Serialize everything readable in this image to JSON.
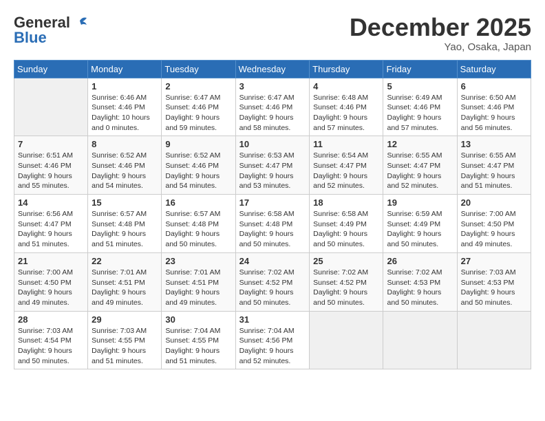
{
  "header": {
    "logo_general": "General",
    "logo_blue": "Blue",
    "month_title": "December 2025",
    "location": "Yao, Osaka, Japan"
  },
  "days_of_week": [
    "Sunday",
    "Monday",
    "Tuesday",
    "Wednesday",
    "Thursday",
    "Friday",
    "Saturday"
  ],
  "weeks": [
    [
      {
        "day": "",
        "content": ""
      },
      {
        "day": "1",
        "content": "Sunrise: 6:46 AM\nSunset: 4:46 PM\nDaylight: 10 hours\nand 0 minutes."
      },
      {
        "day": "2",
        "content": "Sunrise: 6:47 AM\nSunset: 4:46 PM\nDaylight: 9 hours\nand 59 minutes."
      },
      {
        "day": "3",
        "content": "Sunrise: 6:47 AM\nSunset: 4:46 PM\nDaylight: 9 hours\nand 58 minutes."
      },
      {
        "day": "4",
        "content": "Sunrise: 6:48 AM\nSunset: 4:46 PM\nDaylight: 9 hours\nand 57 minutes."
      },
      {
        "day": "5",
        "content": "Sunrise: 6:49 AM\nSunset: 4:46 PM\nDaylight: 9 hours\nand 57 minutes."
      },
      {
        "day": "6",
        "content": "Sunrise: 6:50 AM\nSunset: 4:46 PM\nDaylight: 9 hours\nand 56 minutes."
      }
    ],
    [
      {
        "day": "7",
        "content": "Sunrise: 6:51 AM\nSunset: 4:46 PM\nDaylight: 9 hours\nand 55 minutes."
      },
      {
        "day": "8",
        "content": "Sunrise: 6:52 AM\nSunset: 4:46 PM\nDaylight: 9 hours\nand 54 minutes."
      },
      {
        "day": "9",
        "content": "Sunrise: 6:52 AM\nSunset: 4:46 PM\nDaylight: 9 hours\nand 54 minutes."
      },
      {
        "day": "10",
        "content": "Sunrise: 6:53 AM\nSunset: 4:47 PM\nDaylight: 9 hours\nand 53 minutes."
      },
      {
        "day": "11",
        "content": "Sunrise: 6:54 AM\nSunset: 4:47 PM\nDaylight: 9 hours\nand 52 minutes."
      },
      {
        "day": "12",
        "content": "Sunrise: 6:55 AM\nSunset: 4:47 PM\nDaylight: 9 hours\nand 52 minutes."
      },
      {
        "day": "13",
        "content": "Sunrise: 6:55 AM\nSunset: 4:47 PM\nDaylight: 9 hours\nand 51 minutes."
      }
    ],
    [
      {
        "day": "14",
        "content": "Sunrise: 6:56 AM\nSunset: 4:47 PM\nDaylight: 9 hours\nand 51 minutes."
      },
      {
        "day": "15",
        "content": "Sunrise: 6:57 AM\nSunset: 4:48 PM\nDaylight: 9 hours\nand 51 minutes."
      },
      {
        "day": "16",
        "content": "Sunrise: 6:57 AM\nSunset: 4:48 PM\nDaylight: 9 hours\nand 50 minutes."
      },
      {
        "day": "17",
        "content": "Sunrise: 6:58 AM\nSunset: 4:48 PM\nDaylight: 9 hours\nand 50 minutes."
      },
      {
        "day": "18",
        "content": "Sunrise: 6:58 AM\nSunset: 4:49 PM\nDaylight: 9 hours\nand 50 minutes."
      },
      {
        "day": "19",
        "content": "Sunrise: 6:59 AM\nSunset: 4:49 PM\nDaylight: 9 hours\nand 50 minutes."
      },
      {
        "day": "20",
        "content": "Sunrise: 7:00 AM\nSunset: 4:50 PM\nDaylight: 9 hours\nand 49 minutes."
      }
    ],
    [
      {
        "day": "21",
        "content": "Sunrise: 7:00 AM\nSunset: 4:50 PM\nDaylight: 9 hours\nand 49 minutes."
      },
      {
        "day": "22",
        "content": "Sunrise: 7:01 AM\nSunset: 4:51 PM\nDaylight: 9 hours\nand 49 minutes."
      },
      {
        "day": "23",
        "content": "Sunrise: 7:01 AM\nSunset: 4:51 PM\nDaylight: 9 hours\nand 49 minutes."
      },
      {
        "day": "24",
        "content": "Sunrise: 7:02 AM\nSunset: 4:52 PM\nDaylight: 9 hours\nand 50 minutes."
      },
      {
        "day": "25",
        "content": "Sunrise: 7:02 AM\nSunset: 4:52 PM\nDaylight: 9 hours\nand 50 minutes."
      },
      {
        "day": "26",
        "content": "Sunrise: 7:02 AM\nSunset: 4:53 PM\nDaylight: 9 hours\nand 50 minutes."
      },
      {
        "day": "27",
        "content": "Sunrise: 7:03 AM\nSunset: 4:53 PM\nDaylight: 9 hours\nand 50 minutes."
      }
    ],
    [
      {
        "day": "28",
        "content": "Sunrise: 7:03 AM\nSunset: 4:54 PM\nDaylight: 9 hours\nand 50 minutes."
      },
      {
        "day": "29",
        "content": "Sunrise: 7:03 AM\nSunset: 4:55 PM\nDaylight: 9 hours\nand 51 minutes."
      },
      {
        "day": "30",
        "content": "Sunrise: 7:04 AM\nSunset: 4:55 PM\nDaylight: 9 hours\nand 51 minutes."
      },
      {
        "day": "31",
        "content": "Sunrise: 7:04 AM\nSunset: 4:56 PM\nDaylight: 9 hours\nand 52 minutes."
      },
      {
        "day": "",
        "content": ""
      },
      {
        "day": "",
        "content": ""
      },
      {
        "day": "",
        "content": ""
      }
    ]
  ]
}
